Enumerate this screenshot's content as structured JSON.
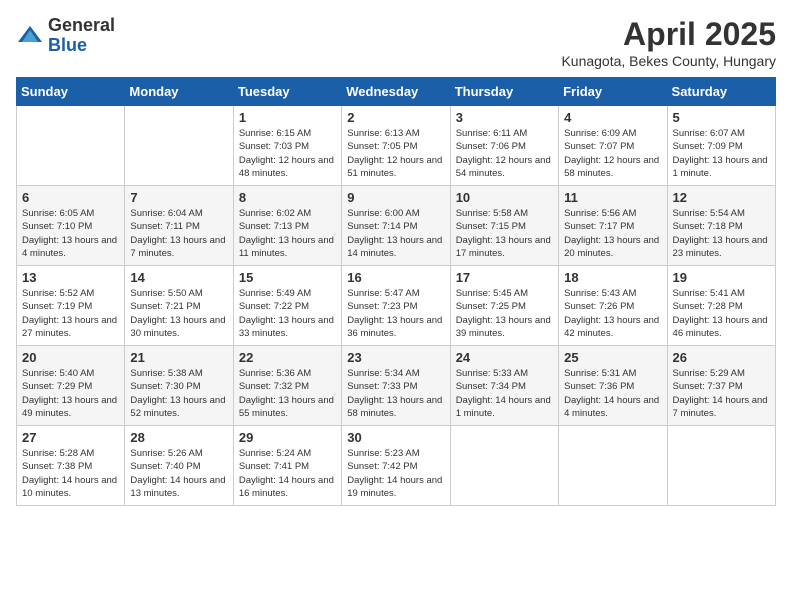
{
  "logo": {
    "general": "General",
    "blue": "Blue"
  },
  "header": {
    "month": "April 2025",
    "location": "Kunagota, Bekes County, Hungary"
  },
  "weekdays": [
    "Sunday",
    "Monday",
    "Tuesday",
    "Wednesday",
    "Thursday",
    "Friday",
    "Saturday"
  ],
  "weeks": [
    [
      {
        "day": "",
        "info": ""
      },
      {
        "day": "",
        "info": ""
      },
      {
        "day": "1",
        "info": "Sunrise: 6:15 AM\nSunset: 7:03 PM\nDaylight: 12 hours and 48 minutes."
      },
      {
        "day": "2",
        "info": "Sunrise: 6:13 AM\nSunset: 7:05 PM\nDaylight: 12 hours and 51 minutes."
      },
      {
        "day": "3",
        "info": "Sunrise: 6:11 AM\nSunset: 7:06 PM\nDaylight: 12 hours and 54 minutes."
      },
      {
        "day": "4",
        "info": "Sunrise: 6:09 AM\nSunset: 7:07 PM\nDaylight: 12 hours and 58 minutes."
      },
      {
        "day": "5",
        "info": "Sunrise: 6:07 AM\nSunset: 7:09 PM\nDaylight: 13 hours and 1 minute."
      }
    ],
    [
      {
        "day": "6",
        "info": "Sunrise: 6:05 AM\nSunset: 7:10 PM\nDaylight: 13 hours and 4 minutes."
      },
      {
        "day": "7",
        "info": "Sunrise: 6:04 AM\nSunset: 7:11 PM\nDaylight: 13 hours and 7 minutes."
      },
      {
        "day": "8",
        "info": "Sunrise: 6:02 AM\nSunset: 7:13 PM\nDaylight: 13 hours and 11 minutes."
      },
      {
        "day": "9",
        "info": "Sunrise: 6:00 AM\nSunset: 7:14 PM\nDaylight: 13 hours and 14 minutes."
      },
      {
        "day": "10",
        "info": "Sunrise: 5:58 AM\nSunset: 7:15 PM\nDaylight: 13 hours and 17 minutes."
      },
      {
        "day": "11",
        "info": "Sunrise: 5:56 AM\nSunset: 7:17 PM\nDaylight: 13 hours and 20 minutes."
      },
      {
        "day": "12",
        "info": "Sunrise: 5:54 AM\nSunset: 7:18 PM\nDaylight: 13 hours and 23 minutes."
      }
    ],
    [
      {
        "day": "13",
        "info": "Sunrise: 5:52 AM\nSunset: 7:19 PM\nDaylight: 13 hours and 27 minutes."
      },
      {
        "day": "14",
        "info": "Sunrise: 5:50 AM\nSunset: 7:21 PM\nDaylight: 13 hours and 30 minutes."
      },
      {
        "day": "15",
        "info": "Sunrise: 5:49 AM\nSunset: 7:22 PM\nDaylight: 13 hours and 33 minutes."
      },
      {
        "day": "16",
        "info": "Sunrise: 5:47 AM\nSunset: 7:23 PM\nDaylight: 13 hours and 36 minutes."
      },
      {
        "day": "17",
        "info": "Sunrise: 5:45 AM\nSunset: 7:25 PM\nDaylight: 13 hours and 39 minutes."
      },
      {
        "day": "18",
        "info": "Sunrise: 5:43 AM\nSunset: 7:26 PM\nDaylight: 13 hours and 42 minutes."
      },
      {
        "day": "19",
        "info": "Sunrise: 5:41 AM\nSunset: 7:28 PM\nDaylight: 13 hours and 46 minutes."
      }
    ],
    [
      {
        "day": "20",
        "info": "Sunrise: 5:40 AM\nSunset: 7:29 PM\nDaylight: 13 hours and 49 minutes."
      },
      {
        "day": "21",
        "info": "Sunrise: 5:38 AM\nSunset: 7:30 PM\nDaylight: 13 hours and 52 minutes."
      },
      {
        "day": "22",
        "info": "Sunrise: 5:36 AM\nSunset: 7:32 PM\nDaylight: 13 hours and 55 minutes."
      },
      {
        "day": "23",
        "info": "Sunrise: 5:34 AM\nSunset: 7:33 PM\nDaylight: 13 hours and 58 minutes."
      },
      {
        "day": "24",
        "info": "Sunrise: 5:33 AM\nSunset: 7:34 PM\nDaylight: 14 hours and 1 minute."
      },
      {
        "day": "25",
        "info": "Sunrise: 5:31 AM\nSunset: 7:36 PM\nDaylight: 14 hours and 4 minutes."
      },
      {
        "day": "26",
        "info": "Sunrise: 5:29 AM\nSunset: 7:37 PM\nDaylight: 14 hours and 7 minutes."
      }
    ],
    [
      {
        "day": "27",
        "info": "Sunrise: 5:28 AM\nSunset: 7:38 PM\nDaylight: 14 hours and 10 minutes."
      },
      {
        "day": "28",
        "info": "Sunrise: 5:26 AM\nSunset: 7:40 PM\nDaylight: 14 hours and 13 minutes."
      },
      {
        "day": "29",
        "info": "Sunrise: 5:24 AM\nSunset: 7:41 PM\nDaylight: 14 hours and 16 minutes."
      },
      {
        "day": "30",
        "info": "Sunrise: 5:23 AM\nSunset: 7:42 PM\nDaylight: 14 hours and 19 minutes."
      },
      {
        "day": "",
        "info": ""
      },
      {
        "day": "",
        "info": ""
      },
      {
        "day": "",
        "info": ""
      }
    ]
  ]
}
